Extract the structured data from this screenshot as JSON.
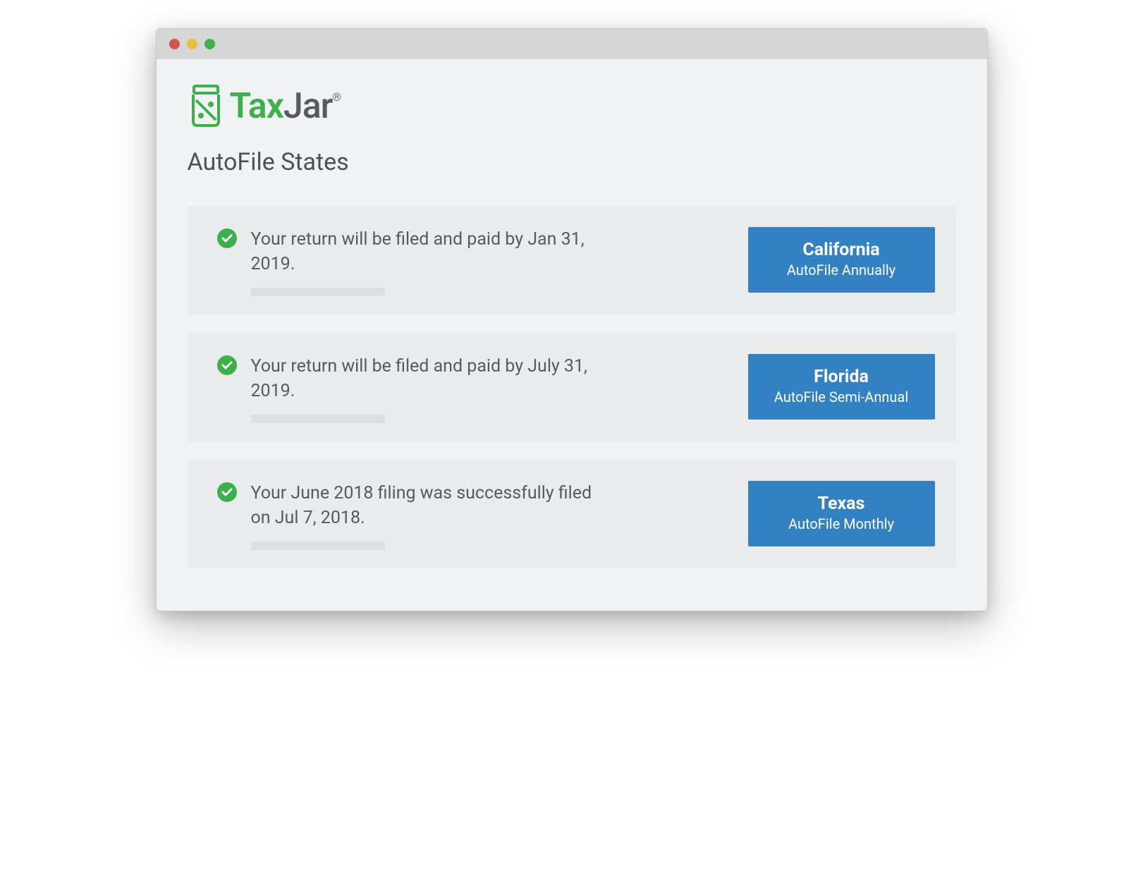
{
  "brand": {
    "name_part1": "Tax",
    "name_part2": "Jar",
    "registered": "®"
  },
  "page": {
    "title": "AutoFile States"
  },
  "cards": [
    {
      "status": "Your return will be filed and paid by Jan 31, 2019.",
      "state": "California",
      "frequency": "AutoFile Annually"
    },
    {
      "status": "Your return will be filed and paid by July 31, 2019.",
      "state": "Florida",
      "frequency": "AutoFile Semi-Annual"
    },
    {
      "status": "Your June 2018 filing was successfully filed on Jul 7, 2018.",
      "state": "Texas",
      "frequency": "AutoFile Monthly"
    }
  ]
}
